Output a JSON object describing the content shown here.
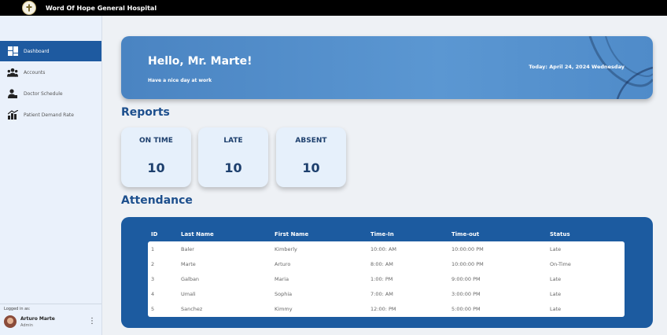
{
  "app": {
    "title": "Word Of Hope General Hospital"
  },
  "sidebar": {
    "items": [
      {
        "label": "Dashboard",
        "icon": "dashboard-icon",
        "active": true
      },
      {
        "label": "Accounts",
        "icon": "users-icon",
        "active": false
      },
      {
        "label": "Doctor Schedule",
        "icon": "doctor-icon",
        "active": false
      },
      {
        "label": "Patient Demand Rate",
        "icon": "chart-icon",
        "active": false
      }
    ],
    "logged_in_label": "Logged in as:",
    "user": {
      "name": "Arturo Marte",
      "role": "Admin"
    }
  },
  "hero": {
    "greeting": "Hello, Mr. Marte!",
    "subtitle": "Have a nice day at work",
    "date": "Today: April 24, 2024 Wednesday"
  },
  "reports": {
    "title": "Reports",
    "cards": [
      {
        "label": "ON TIME",
        "value": "10"
      },
      {
        "label": "LATE",
        "value": "10"
      },
      {
        "label": "ABSENT",
        "value": "10"
      }
    ]
  },
  "attendance": {
    "title": "Attendance",
    "columns": [
      "ID",
      "Last Name",
      "First Name",
      "Time-In",
      "Time-out",
      "Status"
    ],
    "rows": [
      [
        "1",
        "Baler",
        "Kimberly",
        "10:00: AM",
        "10:00:00 PM",
        "Late"
      ],
      [
        "2",
        "Marte",
        "Arturo",
        "8:00: AM",
        "10:00:00 PM",
        "On-Time"
      ],
      [
        "3",
        "Galban",
        "Maria",
        "1:00: PM",
        "9:00:00 PM",
        "Late"
      ],
      [
        "4",
        "Umali",
        "Sophia",
        "7:00: AM",
        "3:00:00 PM",
        "Late"
      ],
      [
        "5",
        "Sanchez",
        "Kimmy",
        "12:00: PM",
        "5:00:00 PM",
        "Late"
      ]
    ]
  },
  "colors": {
    "primary": "#1e5aa0",
    "hero": "#5b97d2",
    "heading": "#1d4f8d",
    "topbar": "#000000"
  }
}
